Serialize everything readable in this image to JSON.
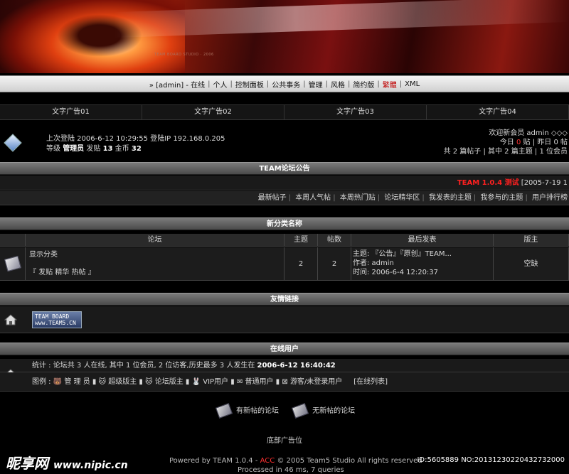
{
  "banner": {
    "small_text": "TEAM BOARD STUDIO · 2006"
  },
  "topnav": {
    "items": [
      "» [admin] - 在线",
      "个人",
      "控制面板",
      "公共事务",
      "管理",
      "风格",
      "简约版",
      "繁體",
      "XML"
    ],
    "highlight_index": 7
  },
  "ads": [
    "文字广告01",
    "文字广告02",
    "文字广告03",
    "文字广告04"
  ],
  "user": {
    "last_login": "上次登陆 2006-6-12 10:29:55 登陆IP 192.168.0.205",
    "level_label": "等级",
    "level": "管理员",
    "posts_label": "发贴",
    "posts": "13",
    "gold_label": "金币",
    "gold": "32",
    "welcome": "欢迎新会员 admin ◇◇◇",
    "today_label": "今日",
    "today": "0",
    "today_unit": "贴 | 昨日 0 帖",
    "totals": "共 2 篇帖子 | 其中 2 篇主题 | 1 位会员"
  },
  "announce": {
    "header": "TEAM论坛公告",
    "title": "TEAM 1.0.4 测试",
    "date": "[2005-7-19 1"
  },
  "links": [
    "最新帖子",
    "本周人气帖",
    "本周热门贴",
    "论坛精华区",
    "我发表的主题",
    "我参与的主题",
    "用户排行榜"
  ],
  "forum": {
    "header": "新分类名称",
    "columns": [
      "论坛",
      "主题",
      "帖数",
      "最后发表",
      "版主"
    ],
    "rows": [
      {
        "name": "显示分类",
        "links": "『 发贴  精华  热帖 』",
        "topics": "2",
        "posts": "2",
        "last_title": "主题: 『公告』『原创』TEAM...",
        "last_author": "作者: admin",
        "last_time": "时间: 2006-6-4 12:20:37",
        "moderator": "空缺"
      }
    ]
  },
  "friends": {
    "header": "友情链接",
    "logo_line1": "TEAM BOARD",
    "logo_line2": "www.TEAM5.CN"
  },
  "online": {
    "header": "在线用户",
    "stats": "统计 : 论坛共 3 人在线, 其中 1 位会员, 2 位访客,历史最多 3 人发生在",
    "record_time": "2006-6-12 16:40:42",
    "legend_label": "图例 :",
    "legend": [
      "管 理 员",
      "超级版主",
      "论坛版主",
      "VIP用户",
      "普通用户",
      "游客/未登录用户"
    ],
    "list_link": "[在线列表]"
  },
  "legend_icons": {
    "new": "有新帖的论坛",
    "nonew": "无新帖的论坛"
  },
  "footer": {
    "ad": "底部广告位",
    "powered": "Powered by TEAM 1.0.4 -",
    "acc": "ACC",
    "copyright": "© 2005 Team5 Studio All rights reserved",
    "processed": "Processed in 46 ms, 7 queries"
  },
  "watermark": {
    "logo": "昵享网",
    "url": "www.nipic.cn",
    "id": "ID:5605889 NO:20131230220432732000"
  }
}
